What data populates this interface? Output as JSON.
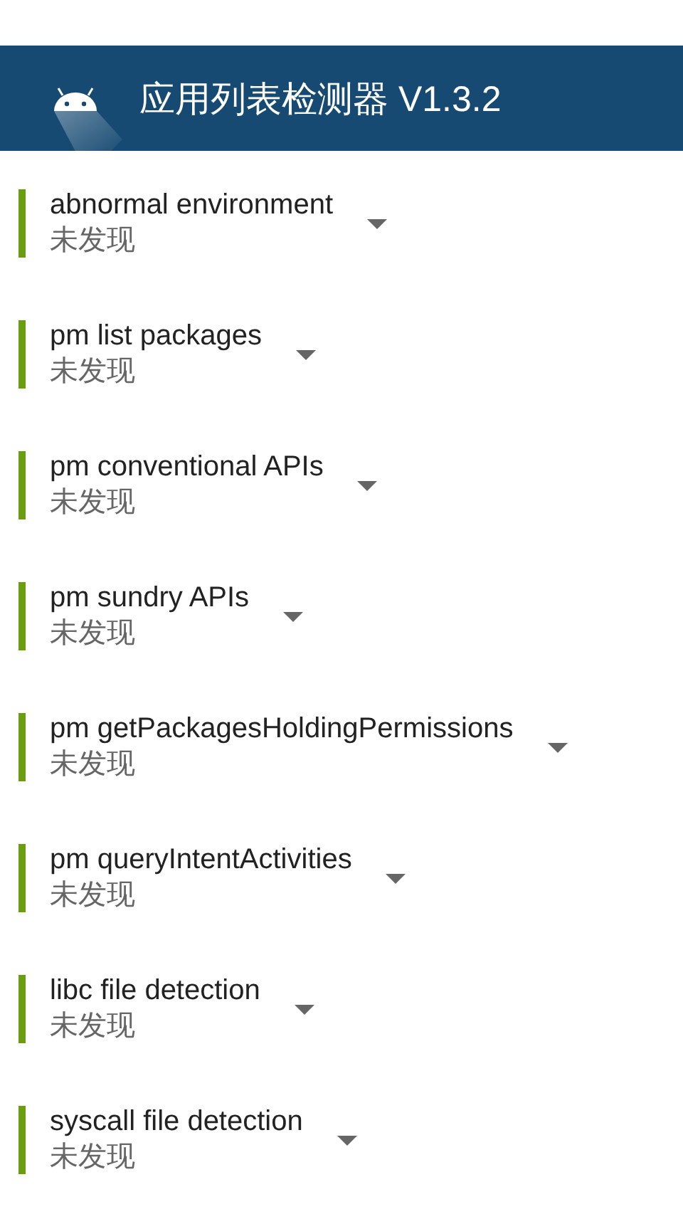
{
  "app_bar": {
    "title": "应用列表检测器 V1.3.2"
  },
  "checks": [
    {
      "name": "abnormal environment",
      "result": "未发现"
    },
    {
      "name": "pm list packages",
      "result": "未发现"
    },
    {
      "name": "pm conventional APIs",
      "result": "未发现"
    },
    {
      "name": "pm sundry APIs",
      "result": "未发现"
    },
    {
      "name": "pm getPackagesHoldingPermissions",
      "result": "未发现"
    },
    {
      "name": "pm queryIntentActivities",
      "result": "未发现"
    },
    {
      "name": "libc file detection",
      "result": "未发现"
    },
    {
      "name": "syscall file detection",
      "result": "未发现"
    }
  ]
}
